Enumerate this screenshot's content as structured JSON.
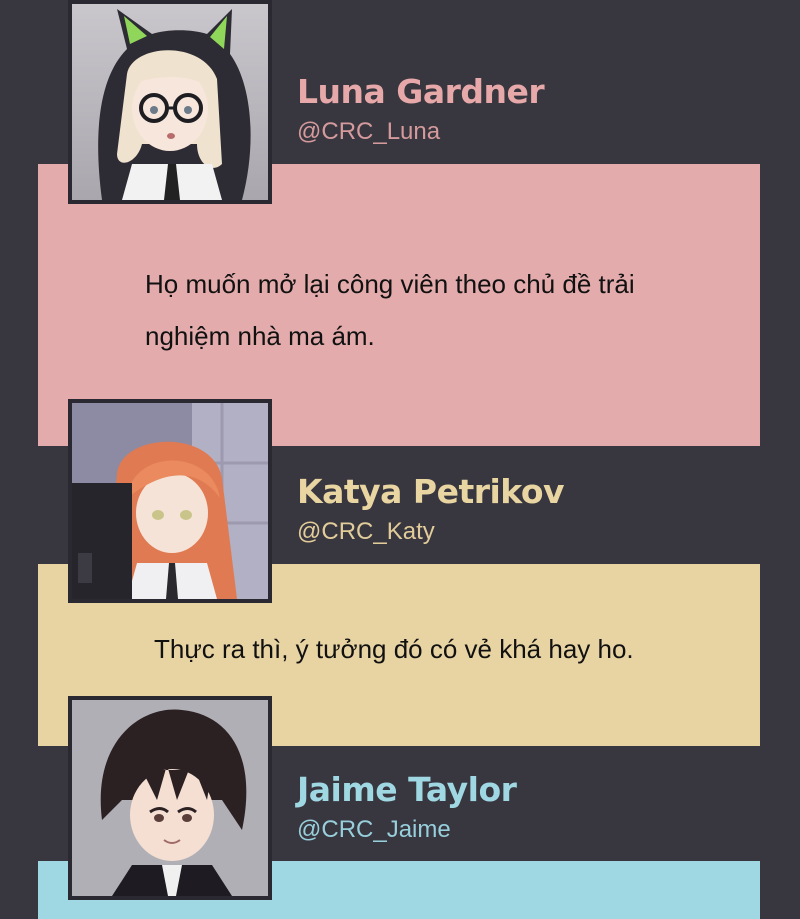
{
  "colors": {
    "background": "#38363f",
    "panel_pink": "#e3abab",
    "panel_yellow": "#e8d3a3",
    "panel_cyan": "#9fd8e3"
  },
  "messages": [
    {
      "name": "Luna Gardner",
      "handle": "@CRC_Luna",
      "text": "Họ muốn mở lại công viên theo chủ đề trải nghiệm nhà ma ám.",
      "avatar_icon": "girl-cat-hood-avatar"
    },
    {
      "name": "Katya Petrikov",
      "handle": "@CRC_Katy",
      "text": "Thực ra thì, ý tưởng đó có vẻ khá hay ho.",
      "avatar_icon": "orange-hair-girl-avatar"
    },
    {
      "name": "Jaime Taylor",
      "handle": "@CRC_Jaime",
      "text": "",
      "avatar_icon": "dark-hair-boy-avatar"
    }
  ]
}
